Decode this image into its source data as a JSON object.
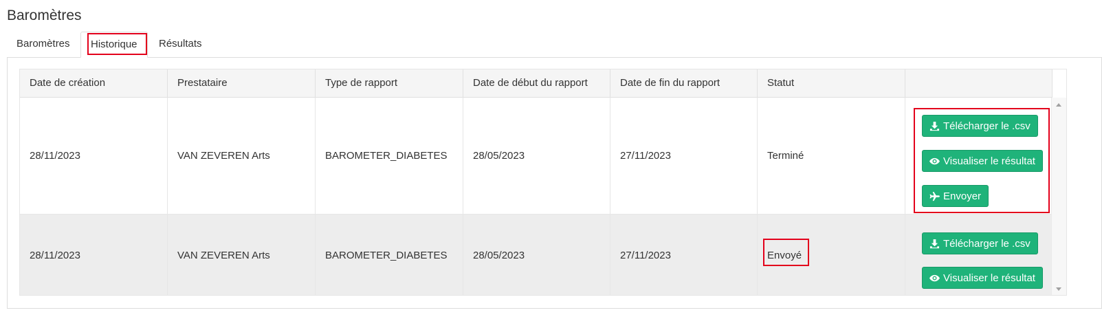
{
  "page": {
    "title": "Baromètres"
  },
  "tabs": [
    {
      "label": "Baromètres"
    },
    {
      "label": "Historique",
      "active": true
    },
    {
      "label": "Résultats"
    }
  ],
  "table": {
    "columns": [
      "Date de création",
      "Prestataire",
      "Type de rapport",
      "Date de début du rapport",
      "Date de fin du rapport",
      "Statut",
      ""
    ],
    "rows": [
      {
        "date_creation": "28/11/2023",
        "prestataire": "VAN ZEVEREN Arts",
        "type": "BAROMETER_DIABETES",
        "date_debut": "28/05/2023",
        "date_fin": "27/11/2023",
        "statut": "Terminé",
        "actions": [
          "Télécharger le .csv",
          "Visualiser le résultat",
          "Envoyer"
        ]
      },
      {
        "date_creation": "28/11/2023",
        "prestataire": "VAN ZEVEREN Arts",
        "type": "BAROMETER_DIABETES",
        "date_debut": "28/05/2023",
        "date_fin": "27/11/2023",
        "statut": "Envoyé",
        "actions": [
          "Télécharger le .csv",
          "Visualiser le résultat"
        ]
      }
    ]
  },
  "icons": {
    "download": "download-icon",
    "view": "eye-icon",
    "send": "plane-icon"
  },
  "colors": {
    "button_green": "#1fb37a",
    "highlight_red": "#e3001b",
    "header_bg": "#f5f5f5",
    "alt_row_bg": "#ededed"
  }
}
